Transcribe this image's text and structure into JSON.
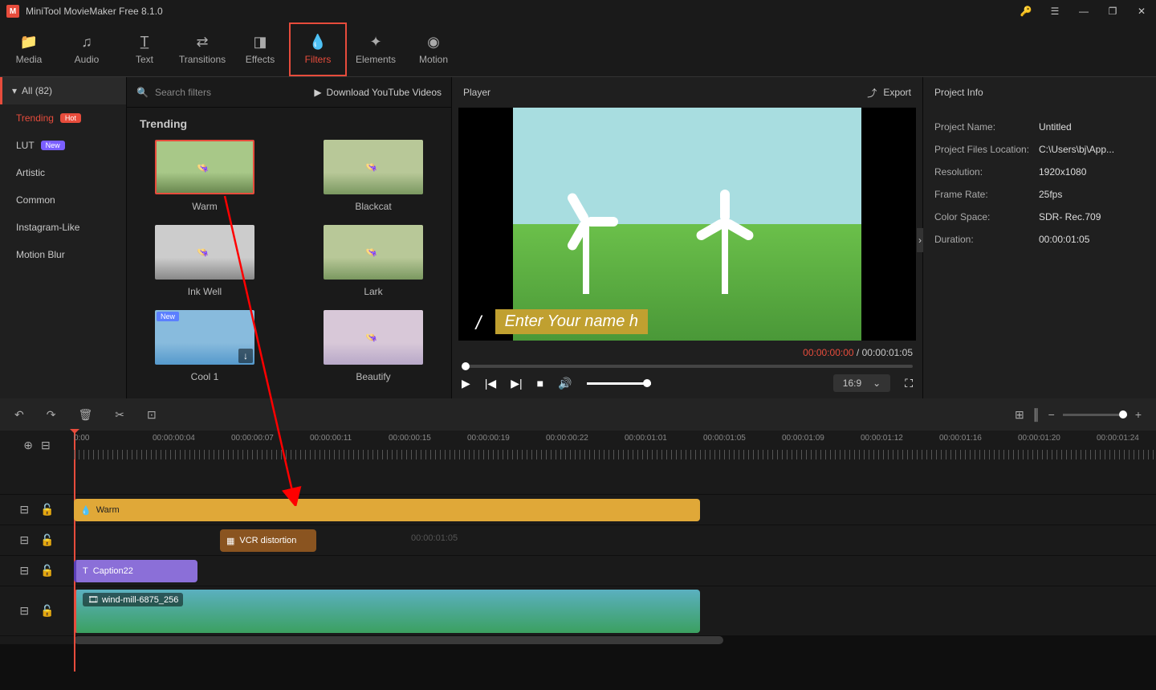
{
  "app": {
    "title": "MiniTool MovieMaker Free 8.1.0"
  },
  "toolbar": {
    "items": [
      {
        "label": "Media",
        "icon": "folder"
      },
      {
        "label": "Audio",
        "icon": "music"
      },
      {
        "label": "Text",
        "icon": "text"
      },
      {
        "label": "Transitions",
        "icon": "transition"
      },
      {
        "label": "Effects",
        "icon": "effects"
      },
      {
        "label": "Filters",
        "icon": "filter",
        "active": true
      },
      {
        "label": "Elements",
        "icon": "elements"
      },
      {
        "label": "Motion",
        "icon": "motion"
      }
    ]
  },
  "sidebar": {
    "header": "All (82)",
    "items": [
      {
        "label": "Trending",
        "badge": "Hot",
        "badgeClass": "hot",
        "active": true
      },
      {
        "label": "LUT",
        "badge": "New",
        "badgeClass": "new"
      },
      {
        "label": "Artistic"
      },
      {
        "label": "Common"
      },
      {
        "label": "Instagram-Like"
      },
      {
        "label": "Motion Blur"
      }
    ]
  },
  "filters": {
    "searchPlaceholder": "Search filters",
    "downloadLink": "Download YouTube Videos",
    "sectionTitle": "Trending",
    "items": [
      {
        "name": "Warm",
        "selected": true
      },
      {
        "name": "Blackcat"
      },
      {
        "name": "Ink Well"
      },
      {
        "name": "Lark"
      },
      {
        "name": "Cool 1",
        "new": true,
        "downloadable": true
      },
      {
        "name": "Beautify"
      }
    ]
  },
  "player": {
    "title": "Player",
    "exportLabel": "Export",
    "overlayText": "Enter Your name h",
    "currentTime": "00:00:00:00",
    "totalTime": "00:00:01:05",
    "ratio": "16:9"
  },
  "projectInfo": {
    "title": "Project Info",
    "rows": [
      {
        "label": "Project Name:",
        "value": "Untitled"
      },
      {
        "label": "Project Files Location:",
        "value": "C:\\Users\\bj\\App..."
      },
      {
        "label": "Resolution:",
        "value": "1920x1080"
      },
      {
        "label": "Frame Rate:",
        "value": "25fps"
      },
      {
        "label": "Color Space:",
        "value": "SDR- Rec.709"
      },
      {
        "label": "Duration:",
        "value": "00:00:01:05"
      }
    ]
  },
  "timeline": {
    "ticks": [
      "0:00",
      "00:00:00:04",
      "00:00:00:07",
      "00:00:00:11",
      "00:00:00:15",
      "00:00:00:19",
      "00:00:00:22",
      "00:00:01:01",
      "00:00:01:05",
      "00:00:01:09",
      "00:00:01:12",
      "00:00:01:16",
      "00:00:01:20",
      "00:00:01:24"
    ],
    "clips": {
      "filter": "Warm",
      "effect": "VCR distortion",
      "caption": "Caption22",
      "video": "wind-mill-6875_256",
      "ghostTime": "00:00:01:05"
    }
  }
}
